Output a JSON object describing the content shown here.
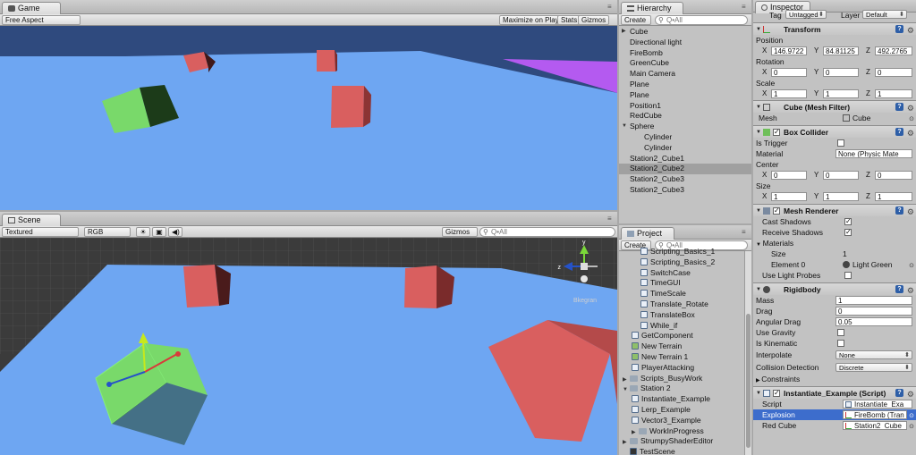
{
  "game": {
    "tab": "Game",
    "aspect": "Free Aspect",
    "maximize": "Maximize on Play",
    "stats": "Stats",
    "gizmos": "Gizmos"
  },
  "scene": {
    "tab": "Scene",
    "render_mode": "Textured",
    "color_mode": "RGB",
    "gizmos": "Gizmos",
    "search_placeholder": "Q•All",
    "persp_label": "Bkegran"
  },
  "hierarchy": {
    "tab": "Hierarchy",
    "create": "Create",
    "search_placeholder": "Q•All",
    "items": [
      {
        "label": "Cube",
        "level": 0,
        "expanded": false,
        "selected": false
      },
      {
        "label": "Directional light",
        "level": 0,
        "selected": false
      },
      {
        "label": "FireBomb",
        "level": 0,
        "selected": false
      },
      {
        "label": "GreenCube",
        "level": 0,
        "selected": false
      },
      {
        "label": "Main Camera",
        "level": 0,
        "selected": false
      },
      {
        "label": "Plane",
        "level": 0,
        "selected": false
      },
      {
        "label": "Plane",
        "level": 0,
        "selected": false
      },
      {
        "label": "Position1",
        "level": 0,
        "selected": false
      },
      {
        "label": "RedCube",
        "level": 0,
        "selected": false
      },
      {
        "label": "Sphere",
        "level": 0,
        "expanded": true,
        "selected": false
      },
      {
        "label": "Cylinder",
        "level": 1,
        "selected": false
      },
      {
        "label": "Cylinder",
        "level": 1,
        "selected": false
      },
      {
        "label": "Station2_Cube1",
        "level": 0,
        "selected": false
      },
      {
        "label": "Station2_Cube2",
        "level": 0,
        "selected": true
      },
      {
        "label": "Station2_Cube3",
        "level": 0,
        "selected": false
      },
      {
        "label": "Station2_Cube3",
        "level": 0,
        "selected": false
      }
    ]
  },
  "project": {
    "tab": "Project",
    "create": "Create",
    "search_placeholder": "Q•All",
    "items": [
      {
        "label": "Scripting_Basics_1",
        "kind": "script",
        "indent": 2
      },
      {
        "label": "Scripting_Basics_2",
        "kind": "script",
        "indent": 2
      },
      {
        "label": "SwitchCase",
        "kind": "script",
        "indent": 2
      },
      {
        "label": "TimeGUI",
        "kind": "script",
        "indent": 2
      },
      {
        "label": "TimeScale",
        "kind": "script",
        "indent": 2
      },
      {
        "label": "Translate_Rotate",
        "kind": "script",
        "indent": 2
      },
      {
        "label": "TranslateBox",
        "kind": "script",
        "indent": 2
      },
      {
        "label": "While_if",
        "kind": "script",
        "indent": 2
      },
      {
        "label": "GetComponent",
        "kind": "script",
        "indent": 1
      },
      {
        "label": "New Terrain",
        "kind": "terrain",
        "indent": 1
      },
      {
        "label": "New Terrain 1",
        "kind": "terrain",
        "indent": 1
      },
      {
        "label": "PlayerAttacking",
        "kind": "script",
        "indent": 1
      },
      {
        "label": "Scripts_BusyWork",
        "kind": "folder",
        "indent": 0,
        "arrow": "▶"
      },
      {
        "label": "Station 2",
        "kind": "folder",
        "indent": 0,
        "arrow": "▼"
      },
      {
        "label": "Instantiate_Example",
        "kind": "script",
        "indent": 1
      },
      {
        "label": "Lerp_Example",
        "kind": "script",
        "indent": 1
      },
      {
        "label": "Vector3_Example",
        "kind": "script",
        "indent": 1
      },
      {
        "label": "WorkInProgress",
        "kind": "folder",
        "indent": 1,
        "arrow": "▶"
      },
      {
        "label": "StrumpyShaderEditor",
        "kind": "folder",
        "indent": 0,
        "arrow": "▶"
      },
      {
        "label": "TestScene",
        "kind": "scene",
        "indent": 0
      }
    ]
  },
  "inspector": {
    "tab": "Inspector",
    "tag_label": "Tag",
    "tag_value": "Untagged",
    "layer_label": "Layer",
    "layer_value": "Default",
    "transform": {
      "title": "Transform",
      "position_label": "Position",
      "rotation_label": "Rotation",
      "scale_label": "Scale",
      "position": {
        "x": "146.9722",
        "y": "84.81125",
        "z": "492.2765"
      },
      "rotation": {
        "x": "0",
        "y": "0",
        "z": "0"
      },
      "scale": {
        "x": "1",
        "y": "1",
        "z": "1"
      }
    },
    "mesh_filter": {
      "title": "Cube (Mesh Filter)",
      "mesh_label": "Mesh",
      "mesh_value": "Cube"
    },
    "box_collider": {
      "title": "Box Collider",
      "is_trigger": "Is Trigger",
      "material": "Material",
      "material_value": "None (Physic Mate",
      "center": "Center",
      "center_v": {
        "x": "0",
        "y": "0",
        "z": "0"
      },
      "size": "Size",
      "size_v": {
        "x": "1",
        "y": "1",
        "z": "1"
      }
    },
    "mesh_renderer": {
      "title": "Mesh Renderer",
      "cast_shadows": "Cast Shadows",
      "receive_shadows": "Receive Shadows",
      "materials": "Materials",
      "size_label": "Size",
      "size_value": "1",
      "element0": "Element 0",
      "element0_value": "Light Green",
      "light_probes": "Use Light Probes"
    },
    "rigidbody": {
      "title": "Rigidbody",
      "mass": "Mass",
      "mass_v": "1",
      "drag": "Drag",
      "drag_v": "0",
      "angular_drag": "Angular Drag",
      "angular_drag_v": "0.05",
      "use_gravity": "Use Gravity",
      "is_kinematic": "Is Kinematic",
      "interpolate": "Interpolate",
      "interpolate_v": "None",
      "collision": "Collision Detection",
      "collision_v": "Discrete",
      "constraints": "Constraints"
    },
    "script_comp": {
      "title": "Instantiate_Example (Script)",
      "script": "Script",
      "script_v": "Instantiate_Exa",
      "explosion": "Explosion",
      "explosion_v": "FireBomb (Tran",
      "red_cube": "Red Cube",
      "red_cube_v": "Station2_Cube"
    }
  },
  "colors": {
    "sky": "#2f4a7e",
    "plane": "#6ea6f2",
    "red_cube": "#d95f5f",
    "green_cube": "#79d96a",
    "selected_row": "#3d6dcc"
  }
}
